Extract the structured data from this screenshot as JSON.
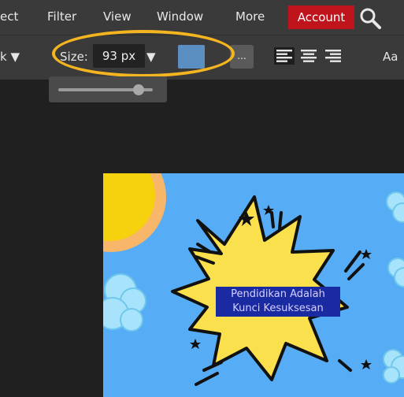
{
  "menu": {
    "items": [
      {
        "label": "ect"
      },
      {
        "label": "Filter"
      },
      {
        "label": "View"
      },
      {
        "label": "Window"
      },
      {
        "label": "More"
      }
    ],
    "account_label": "Account"
  },
  "toolbar": {
    "style_label": "k ▼",
    "size_label": "Size:",
    "size_value": "93 px",
    "size_arrow": "▼",
    "swatch_color": "#5b8fc2",
    "more_label": "...",
    "font_label": "Aa",
    "slider_level": 0.85
  },
  "canvas": {
    "text_line1": "Pendidikan Adalah",
    "text_line2": "Kunci Kesuksesan"
  }
}
